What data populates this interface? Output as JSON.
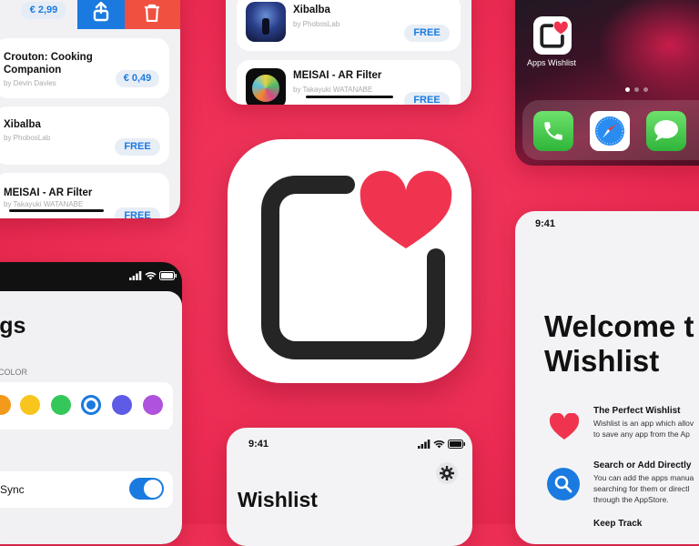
{
  "left_list": {
    "top_price": "€ 2,99",
    "items": [
      {
        "name_line1": "Crouton: Cooking",
        "name_line2": "Companion",
        "developer": "by Devin Davies",
        "price": "€ 0,49"
      },
      {
        "name_line1": "Xibalba",
        "name_line2": "",
        "developer": "by PhobosLab",
        "price": "FREE"
      },
      {
        "name_line1": "MEISAI - AR Filter",
        "name_line2": "",
        "developer": "by Takayuki WATANABE",
        "price": "FREE"
      }
    ]
  },
  "center_list": {
    "items": [
      {
        "name": "Xibalba",
        "developer": "by PhobosLab",
        "price": "FREE"
      },
      {
        "name": "MEISAI - AR Filter",
        "developer": "by Takayuki WATANABE",
        "price": "FREE"
      }
    ]
  },
  "home_screen": {
    "app_label": "Apps Wishlist",
    "dock": [
      "phone-icon",
      "safari-icon",
      "messages-icon"
    ]
  },
  "settings": {
    "title_fragment": "ngs",
    "section_label": "COLOR",
    "colors": [
      "#f39a1c",
      "#f8c51c",
      "#34c759",
      "#1a7ae0",
      "#5e5ce6",
      "#af52de"
    ],
    "selected_color_index": 3,
    "sync_label": "Sync",
    "sync_on": true
  },
  "wishlist_screen": {
    "time": "9:41",
    "title": "Wishlist"
  },
  "welcome_screen": {
    "time": "9:41",
    "title_line1": "Welcome t",
    "title_line2": "Wishlist",
    "features": [
      {
        "icon": "heart-icon",
        "title": "The Perfect Wishlist",
        "line1": "Wishlist is an app which allov",
        "line2": "to save any app from the Ap"
      },
      {
        "icon": "search-icon",
        "title": "Search or Add Directly",
        "line1": "You can add the apps manua",
        "line2": "searching for them or directl",
        "line3": "through the AppStore."
      },
      {
        "title": "Keep Track"
      }
    ]
  },
  "colors": {
    "background": "#ee2f55",
    "accent": "#1a7ae0",
    "heart": "#f0344f"
  }
}
